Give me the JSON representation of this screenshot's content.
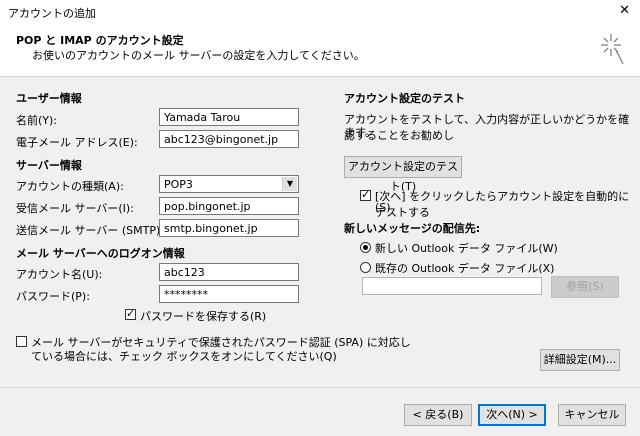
{
  "window": {
    "title": "アカウントの追加",
    "close_glyph": "✕"
  },
  "header": {
    "title": "POP と IMAP のアカウント設定",
    "subtitle": "お使いのアカウントのメール サーバーの設定を入力してください。"
  },
  "user_info": {
    "section": "ユーザー情報",
    "name_label": "名前(Y):",
    "name_value": "Yamada Tarou",
    "email_label": "電子メール アドレス(E):",
    "email_value": "abc123@bingonet.jp"
  },
  "server_info": {
    "section": "サーバー情報",
    "account_type_label": "アカウントの種類(A):",
    "account_type_value": "POP3",
    "incoming_label": "受信メール サーバー(I):",
    "incoming_value": "pop.bingonet.jp",
    "outgoing_label": "送信メール サーバー (SMTP)(O):",
    "outgoing_value": "smtp.bingonet.jp"
  },
  "logon_info": {
    "section": "メール サーバーへのログオン情報",
    "account_name_label": "アカウント名(U):",
    "account_name_value": "abc123",
    "password_label": "パスワード(P):",
    "password_value": "********",
    "save_password_label": "パスワードを保存する(R)",
    "spa_label_line1": "メール サーバーがセキュリティで保護されたパスワード認証 (SPA) に対応し",
    "spa_label_line2": "ている場合には、チェック ボックスをオンにしてください(Q)"
  },
  "test": {
    "section": "アカウント設定のテスト",
    "desc_line1": "アカウントをテストして、入力内容が正しいかどうかを確認することをお勧めし",
    "desc_line2": "ます。",
    "test_button": "アカウント設定のテスト(T)",
    "auto_test_line1": "[次へ] をクリックしたらアカウント設定を自動的にテストする",
    "auto_test_line2": "(S)"
  },
  "delivery": {
    "section": "新しいメッセージの配信先:",
    "new_file_label": "新しい Outlook データ ファイル(W)",
    "existing_file_label": "既存の Outlook データ ファイル(X)",
    "browse_button": "参照(S)"
  },
  "more_settings_button": "詳細設定(M)...",
  "footer": {
    "back_button": "< 戻る(B)",
    "next_button": "次へ(N) >",
    "cancel_button": "キャンセル"
  },
  "icons": {
    "sparkle": "sparkle-icon",
    "checkmark": "checkmark-icon",
    "dropdown": "chevron-down-icon"
  }
}
